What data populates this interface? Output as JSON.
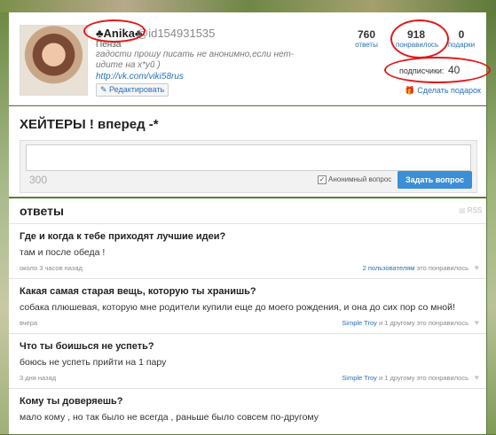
{
  "profile": {
    "username": "♣Anika♣",
    "user_id": "@id154931535",
    "city": "Пенза",
    "bio": "гадости прошу писать не анонимно,если нет-идите на х*уй )",
    "link": "http://vk.com/viki58rus",
    "edit_label": "Редактировать",
    "stats": [
      {
        "value": "760",
        "label": "ответы"
      },
      {
        "value": "918",
        "label": "понравилось"
      },
      {
        "value": "0",
        "label": "подарки"
      }
    ],
    "subscribers_label": "подписчики:",
    "subscribers_value": "40",
    "gift_label": "Сделать подарок",
    "gift_icon": "gift-icon",
    "annotation_color": "#e01b1b"
  },
  "ask": {
    "title": "ХЕЙТЕРЫ ! вперед -*",
    "counter": "300",
    "anon_label": "Анонимный вопрос",
    "anon_checked": true,
    "button_label": "Задать вопрос",
    "button_color": "#3a8fd6"
  },
  "answers": {
    "title": "ответы",
    "rss_label": "RSS",
    "items": [
      {
        "question": "Где и когда к тебе приходят лучшие идеи?",
        "answer": "там и после обеда !",
        "time": "около 3 часов назад",
        "likes_link": "2 пользователям",
        "likes_rest": " это понравилось"
      },
      {
        "question": "Какая самая старая вещь, которую ты хранишь?",
        "answer": "собака плюшевая, которую мне родители купили еще до моего рождения, и она до сих пор со мной!",
        "time": "вчера",
        "likes_link": "Simple Troy",
        "likes_rest": " и 1 другому это понравилось"
      },
      {
        "question": "Что ты боишься не успеть?",
        "answer": "боюсь не успеть прийти на 1 пару",
        "time": "3 дня назад",
        "likes_link": "Simple Troy",
        "likes_rest": " и 1 другому это понравилось"
      },
      {
        "question": "Кому ты доверяешь?",
        "answer": "мало кому , но так было не всегда , раньше было совсем по-другому",
        "time": "",
        "likes_link": "",
        "likes_rest": ""
      }
    ]
  }
}
